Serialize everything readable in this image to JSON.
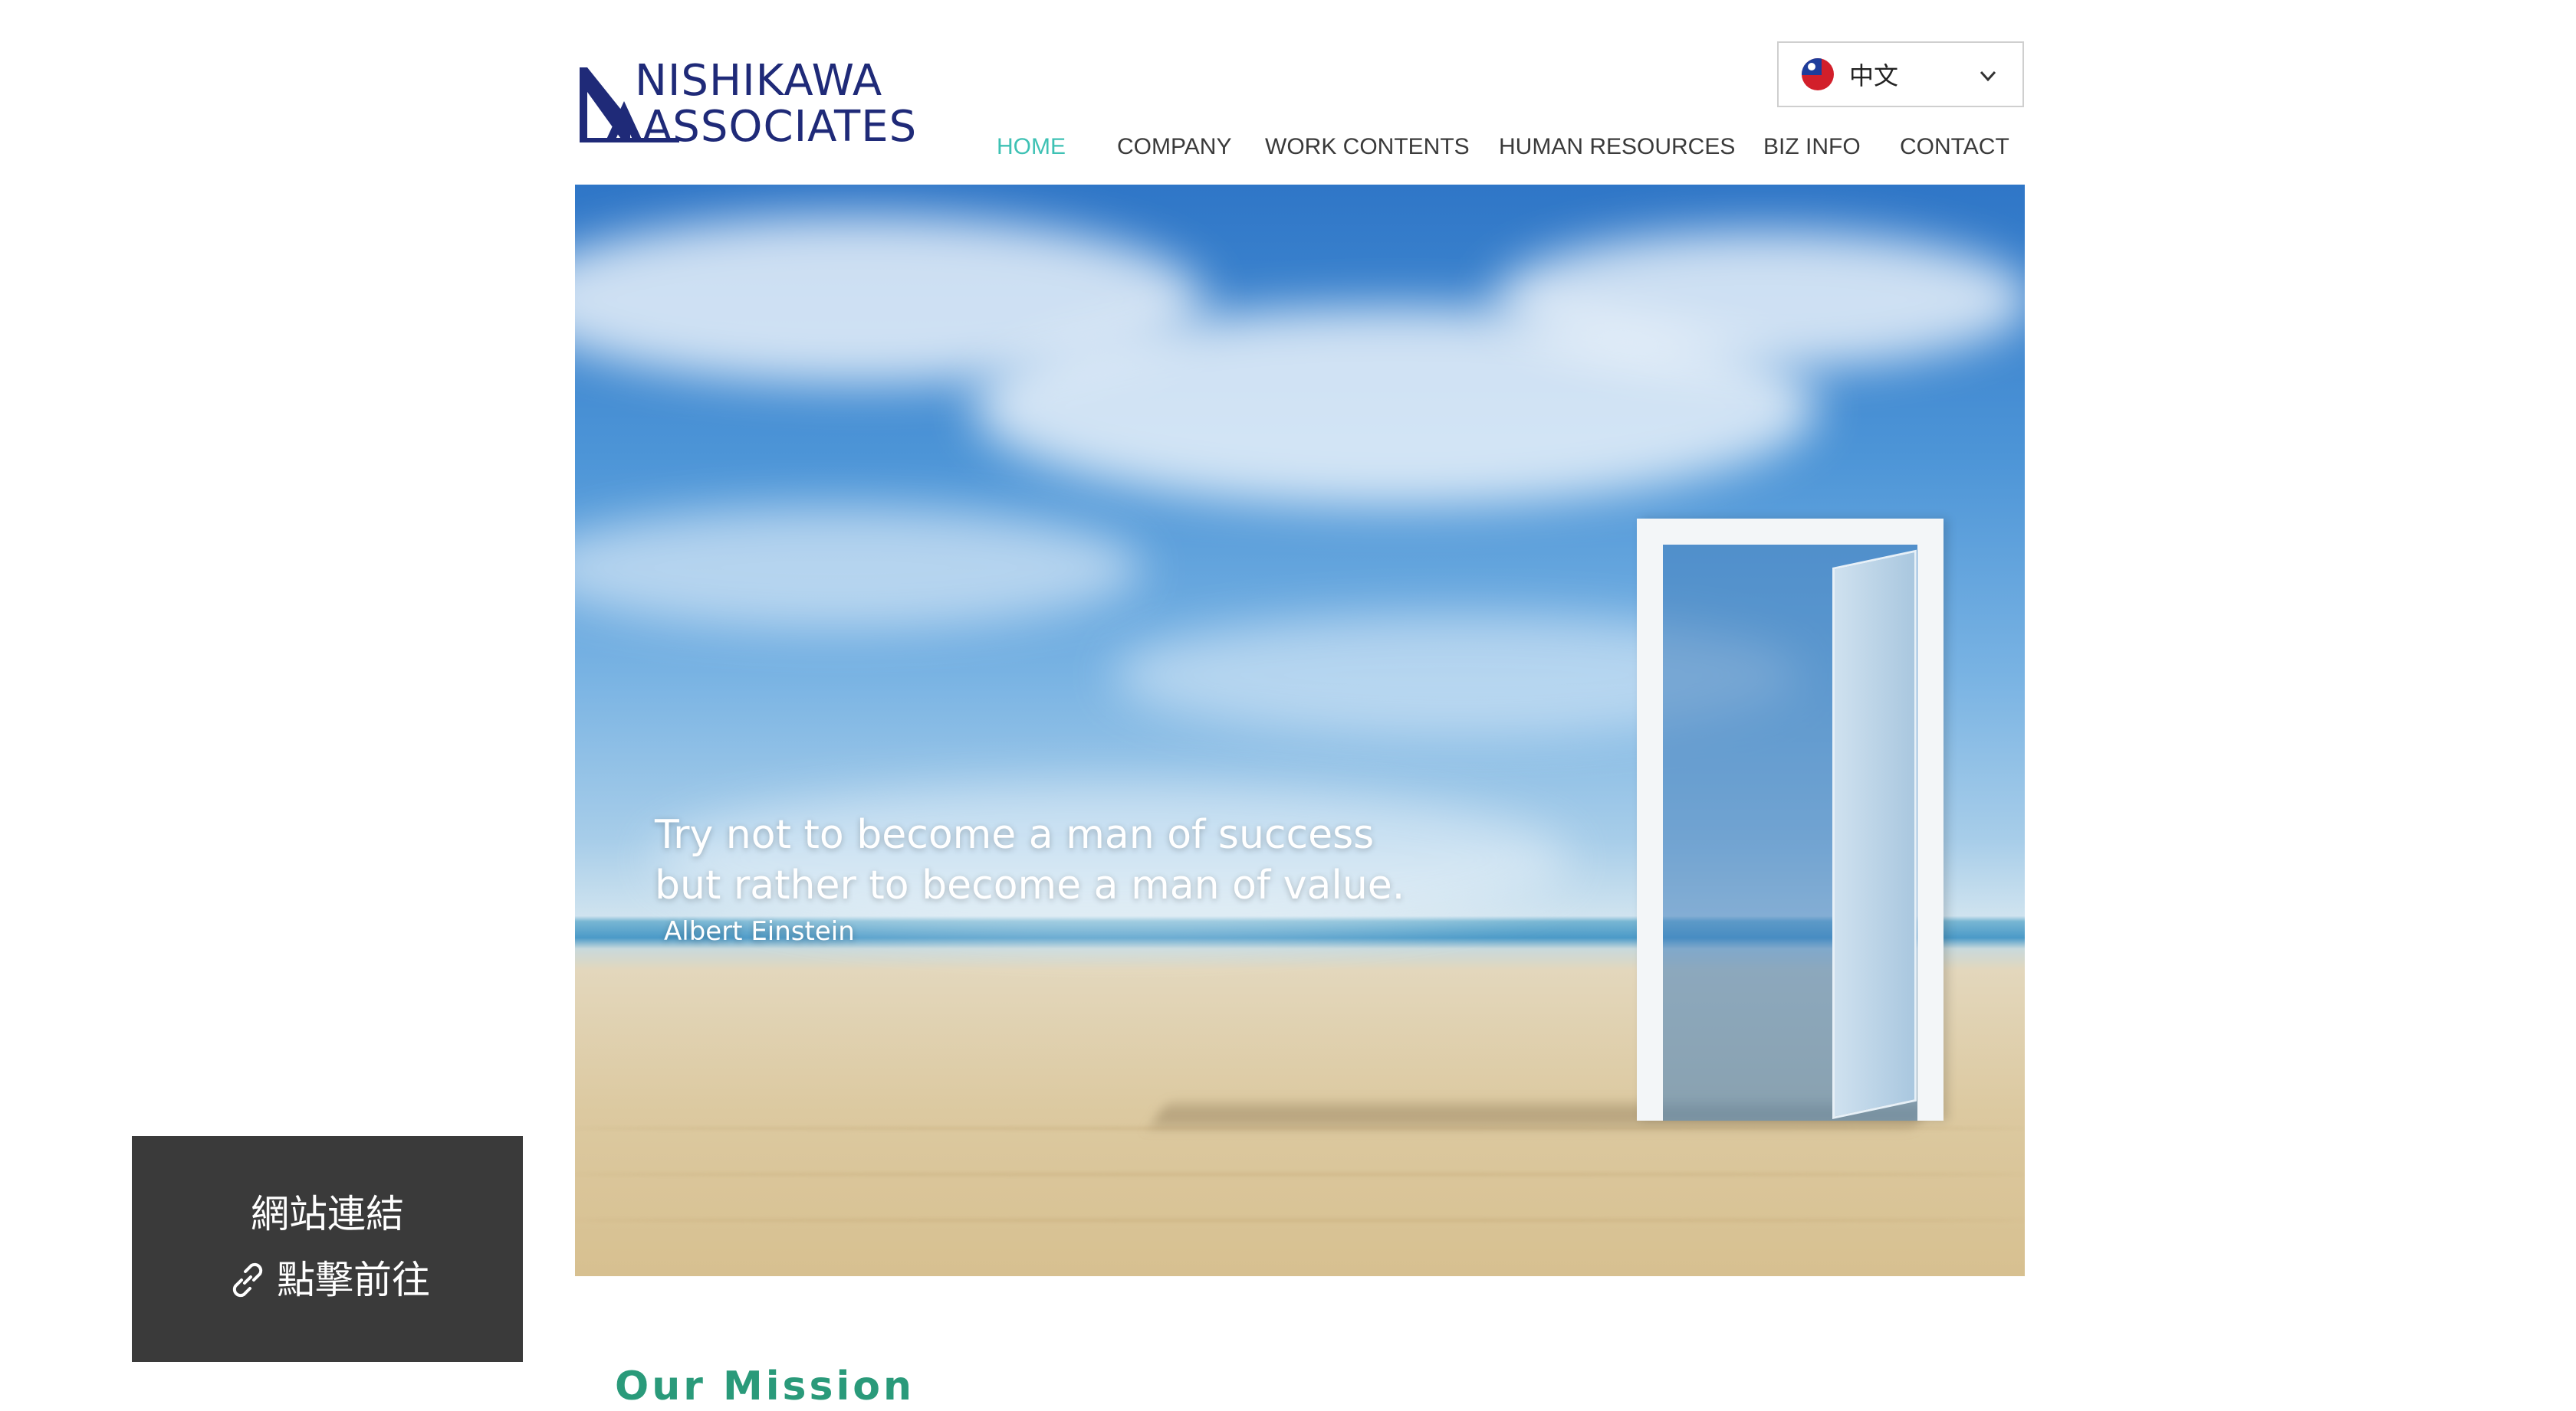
{
  "header": {
    "logo": {
      "line1": "NISHIKAWA",
      "line2": "ASSOCIATES",
      "icon": "na-monogram-logo"
    },
    "language_selector": {
      "selected": "中文",
      "flag_icon": "taiwan-flag-icon",
      "chevron_icon": "chevron-down-icon"
    },
    "nav": {
      "items": [
        {
          "label": "HOME",
          "active": true
        },
        {
          "label": "COMPANY",
          "active": false
        },
        {
          "label": "WORK CONTENTS",
          "active": false
        },
        {
          "label": "HUMAN RESOURCES",
          "active": false
        },
        {
          "label": "BIZ INFO",
          "active": false
        },
        {
          "label": "CONTACT",
          "active": false
        }
      ]
    }
  },
  "hero": {
    "quote_line1": "Try not to become a man of success",
    "quote_line2": "but rather to become a man of value.",
    "author": "Albert Einstein"
  },
  "link_widget": {
    "title": "網站連結",
    "action": "點擊前往",
    "icon": "link-icon"
  },
  "section": {
    "title": "Our Mission"
  },
  "colors": {
    "brand_navy": "#1f2a78",
    "nav_active": "#3ec1b4",
    "nav_text": "#3a3a3a",
    "section_title": "#2a9a7a",
    "widget_bg": "#3a3a3a"
  }
}
